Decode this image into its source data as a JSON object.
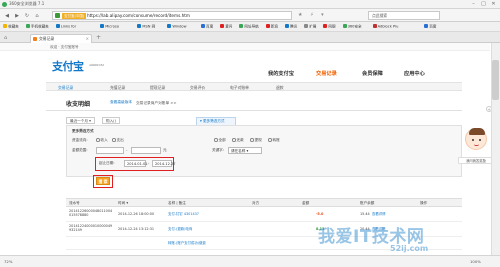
{
  "browser": {
    "title": "360安全浏览器 7.1",
    "url_badge": "支付宝(中国)",
    "url": "https://lab.alipay.com/consume/record/items.htm",
    "search_placeholder": "点此搜索",
    "zoom": "100%",
    "status": "72%"
  },
  "bookmarks": [
    {
      "label": "收藏夹",
      "color": "#f5b400"
    },
    {
      "label": "手机收藏夹",
      "color": "#3aa757"
    },
    {
      "label": "Links for",
      "color": "#1478c8"
    },
    {
      "label": "Microso",
      "color": "#1478c8"
    },
    {
      "label": "MSN 网",
      "color": "#1478c8"
    },
    {
      "label": "Window",
      "color": "#1478c8"
    },
    {
      "label": "百度",
      "color": "#2a6fd6"
    },
    {
      "label": "爱问",
      "color": "#e02020"
    },
    {
      "label": "网址导航",
      "color": "#3aa757"
    },
    {
      "label": "新浪",
      "color": "#e02020"
    },
    {
      "label": "腾讯",
      "color": "#1478c8"
    },
    {
      "label": "扩展",
      "color": "#888888"
    },
    {
      "label": "网银",
      "color": "#e02020"
    },
    {
      "label": "360安全",
      "color": "#3aa757"
    },
    {
      "label": "Adblock Plu",
      "color": "#c03030"
    },
    {
      "label": "百度",
      "color": "#2a6fd6"
    }
  ],
  "tab": {
    "label": "交易记录",
    "close": "×"
  },
  "site": {
    "top_links": "欢迎 · 支付宝账号",
    "logo": "支付宝",
    "logo_sub": "ALIPAY.COM",
    "nav": [
      "我的支付宝",
      "交易记录",
      "会员保障",
      "应用中心"
    ],
    "subnav": [
      "交易记录",
      "充值记录",
      "提现记录",
      "交易评价",
      "电子对账单",
      "退款"
    ]
  },
  "section": {
    "title": "收支明细",
    "link1": "查看高级版本",
    "link2": "交易记录商户对账单 >>"
  },
  "quick": [
    "最近一个月 ▾",
    "购入()",
    "▾ 更多筛选方式"
  ],
  "filter": {
    "heading": "更多筛选方式",
    "type_label": "资金流向:",
    "type_opts": [
      "收入",
      "支出"
    ],
    "amount_label": "金额范围:",
    "amount_sep": "-",
    "amount_unit": "元",
    "time_label": "起止日期:",
    "date_from": "2014.01.01",
    "date_sep": "-",
    "date_to": "2014.12.27",
    "right_opts": [
      "全部",
      "还款",
      "提现",
      "转账"
    ],
    "keyword_label": "关键字:",
    "keyword_select": "请在名称 ▾",
    "search_btn": "搜 索"
  },
  "table": {
    "headers": [
      "流水号",
      "时间 ▾",
      "名称 | 备注",
      "对方",
      "金额",
      "账户余额",
      "操作"
    ],
    "rows": [
      {
        "id": "20141226000048011004\n015578880",
        "time": "2014-12-26 18:00:00",
        "name": "支付-钉钉 4301437",
        "amount": "-5.0",
        "balance": "15.44",
        "op": "查看详情"
      },
      {
        "id": "20141224000010000049\n932149",
        "time": "2014-12-24 13:12:31",
        "name": "支付-(退款)电商",
        "amount": "8.13",
        "balance": "20.44",
        "op": "查看详情"
      },
      {
        "id": "",
        "time": "",
        "name": "转账-(账户支付成功)缴费",
        "amount": "",
        "balance": "",
        "op": ""
      }
    ]
  },
  "side": {
    "mascot_label": "我问我答奖励"
  },
  "watermark": {
    "line1": "我爱IT技术网",
    "line2": "52ij.com"
  }
}
